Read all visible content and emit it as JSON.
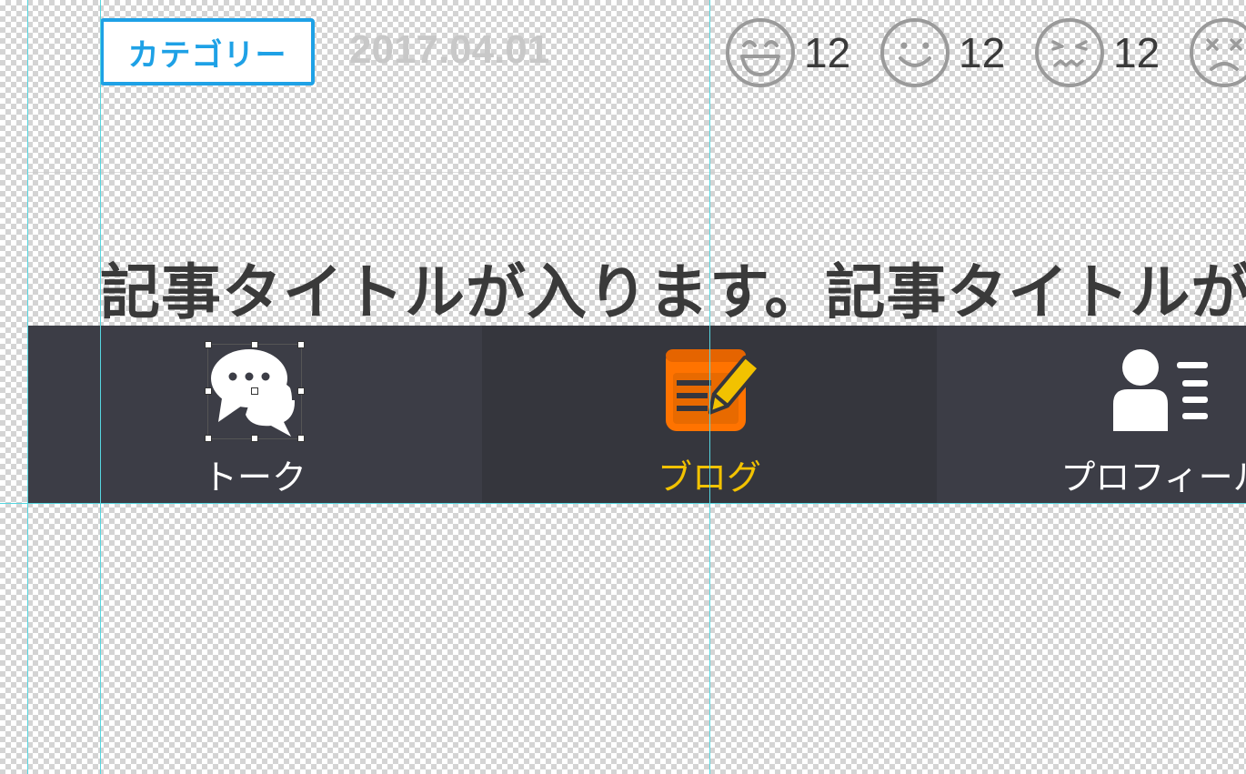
{
  "header": {
    "category_label": "カテゴリー",
    "date": "2017.04.01"
  },
  "reactions": [
    {
      "icon": "laughing-face-icon",
      "count": "12"
    },
    {
      "icon": "smiling-face-icon",
      "count": "12"
    },
    {
      "icon": "worried-face-icon",
      "count": "12"
    },
    {
      "icon": "frowning-face-icon",
      "count": ""
    }
  ],
  "article": {
    "title": "記事タイトルが入ります。記事タイトルが"
  },
  "tabs": [
    {
      "label": "トーク",
      "icon": "chat-bubbles-icon",
      "active": false
    },
    {
      "label": "ブログ",
      "icon": "blog-notebook-icon",
      "active": true
    },
    {
      "label": "プロフィール",
      "icon": "profile-icon",
      "active": false
    }
  ],
  "colors": {
    "accent_blue": "#1ea1e6",
    "active_tab_text": "#f2c200",
    "blog_icon_orange": "#ff7300",
    "tab_bar_bg": "#3c3d46",
    "guide": "#56d6e0"
  }
}
